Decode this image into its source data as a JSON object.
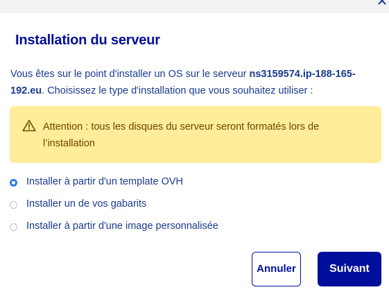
{
  "modal": {
    "title": "Installation du serveur",
    "intro_prefix": "Vous êtes sur le point d'installer un OS sur le serveur ",
    "server_name": "ns3159574.ip-188-165-192.eu",
    "intro_suffix": ". Choisissez le type d'installation que vous souhaitez utiliser :"
  },
  "warning": {
    "icon": "warning-triangle-icon",
    "text": "Attention : tous les disques du serveur seront formatés lors de l’installation"
  },
  "options": [
    {
      "label": "Installer à partir d'un template OVH",
      "selected": true
    },
    {
      "label": "Installer un de vos gabarits",
      "selected": false
    },
    {
      "label": "Installer à partir d'une image personnalisée",
      "selected": false
    }
  ],
  "buttons": {
    "cancel_label": "Annuler",
    "next_label": "Suivant"
  },
  "colors": {
    "primary": "#000e9c",
    "text": "#1a3a8f",
    "warning_bg": "#ffed9a",
    "warning_text": "#6e4400",
    "radio_selected": "#2d7fe6"
  }
}
